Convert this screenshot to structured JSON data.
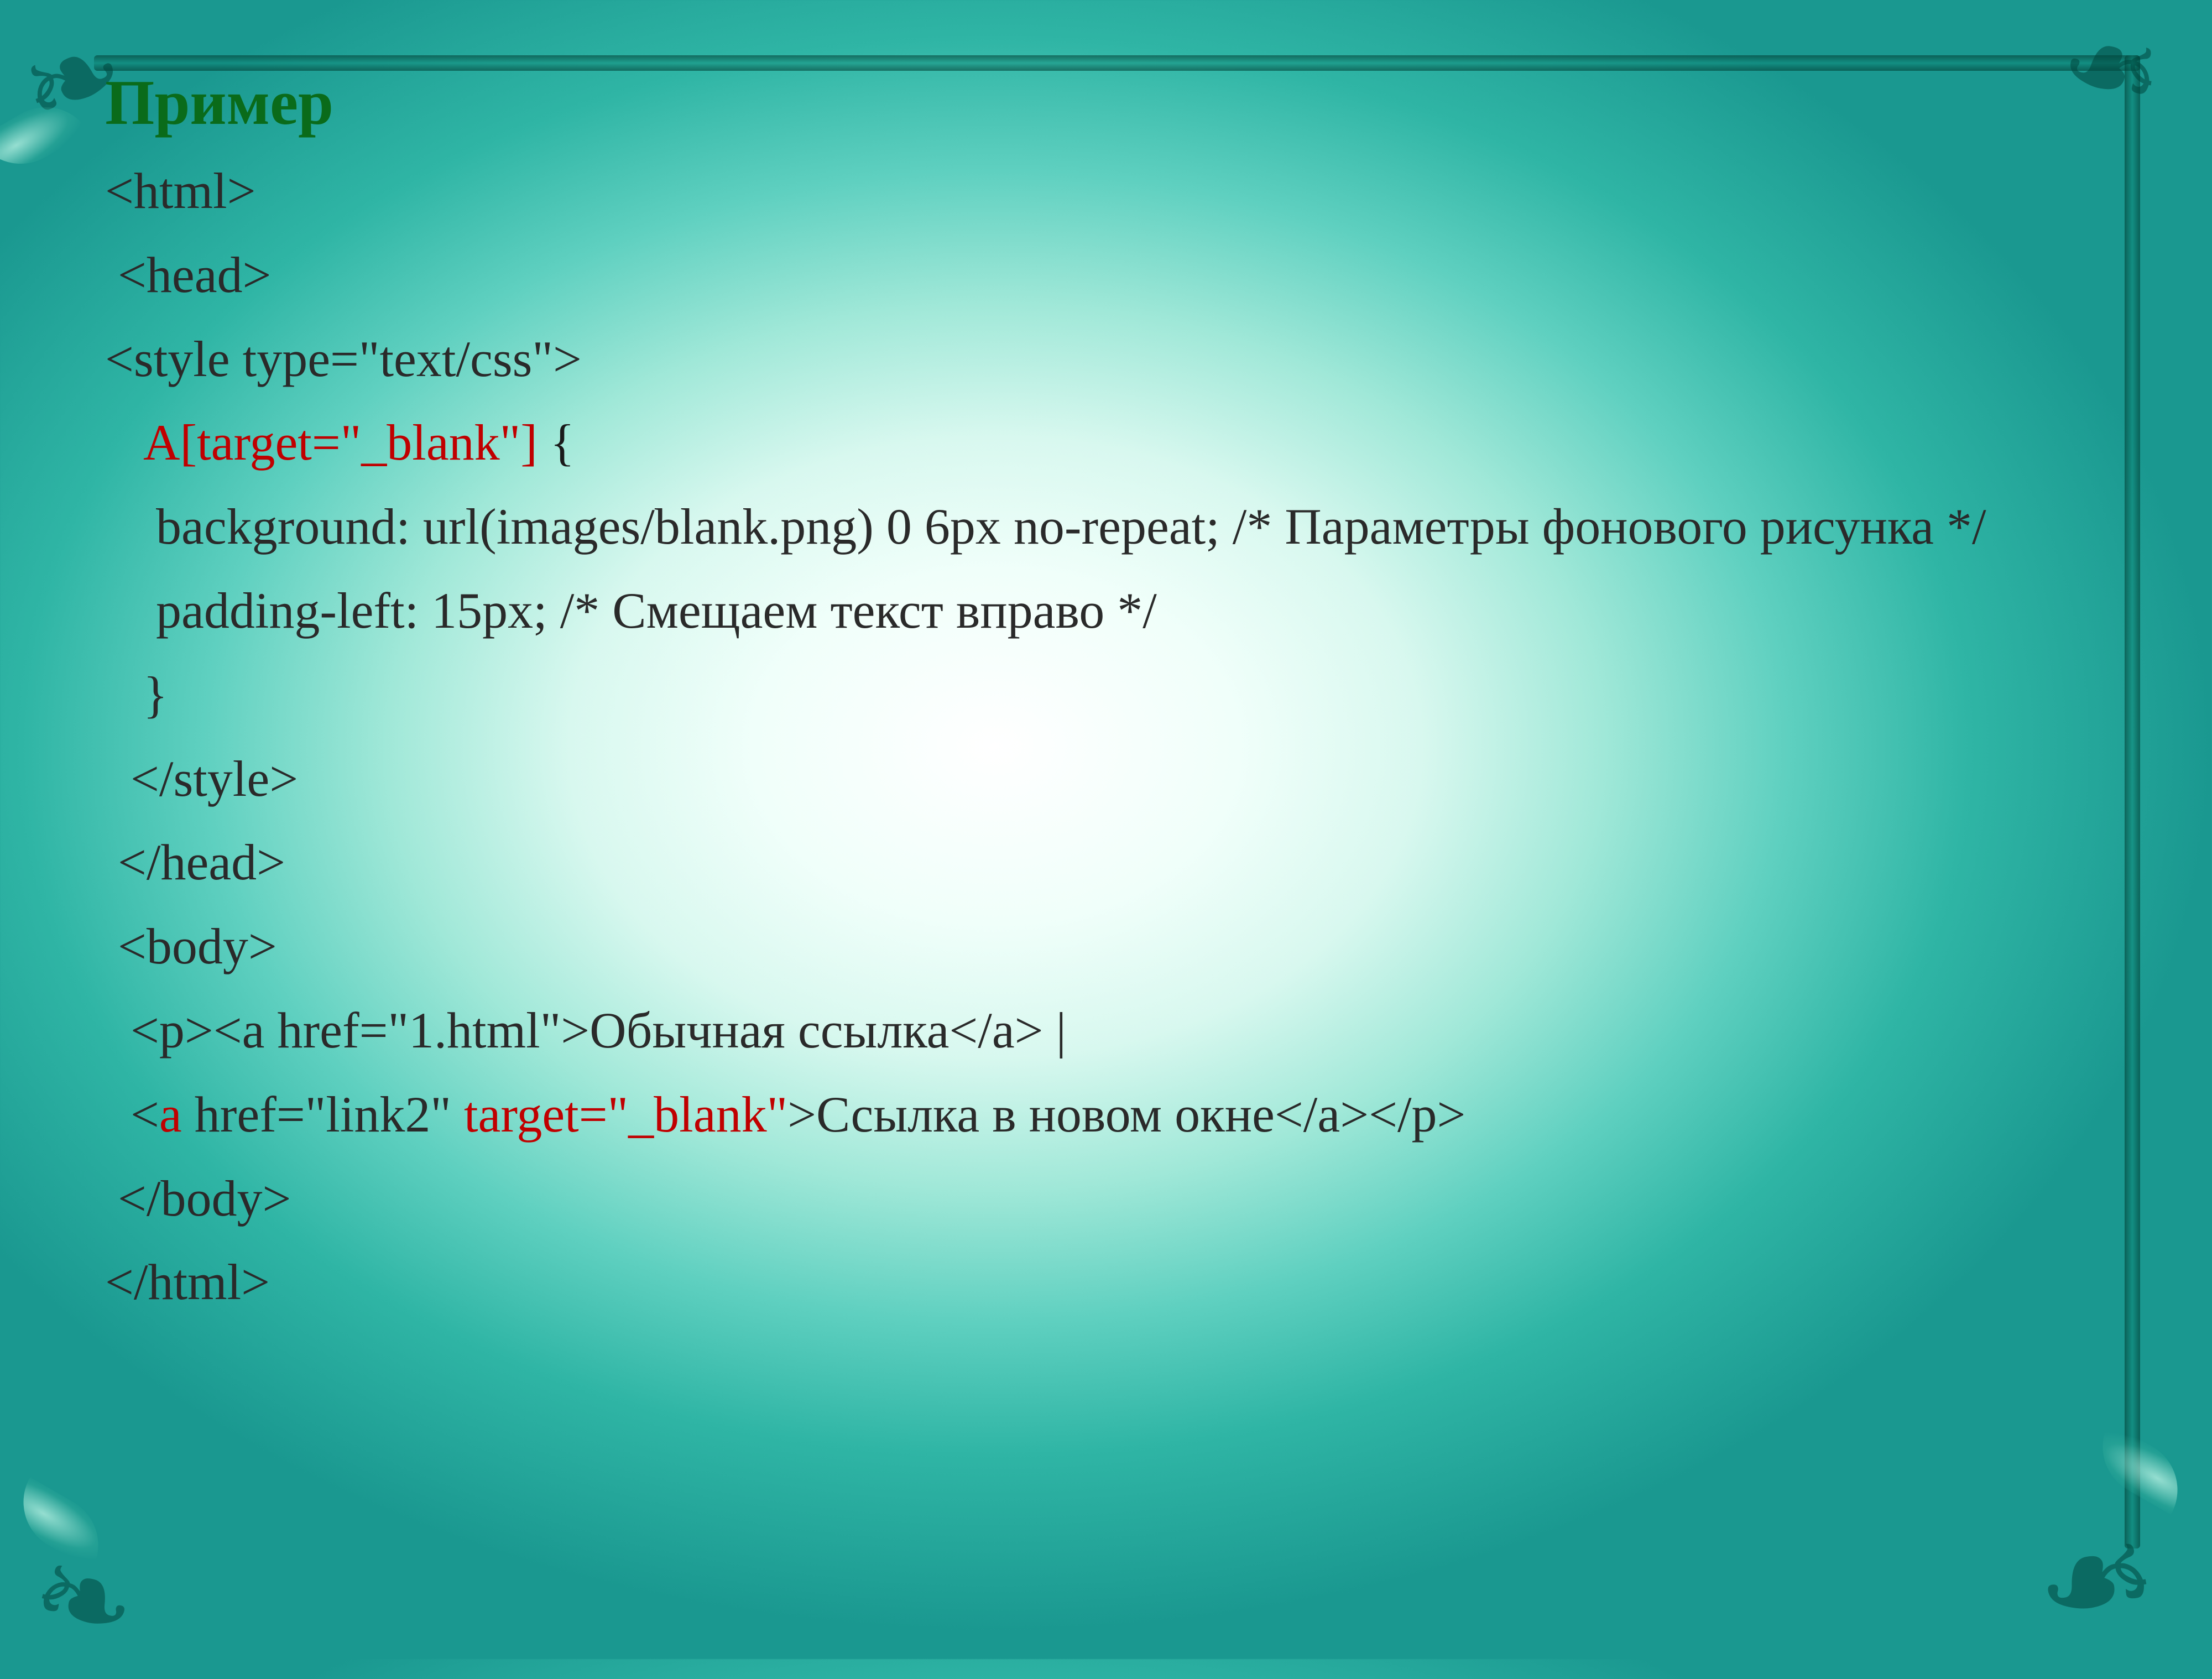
{
  "title": "Пример",
  "code": {
    "l01": "<html>",
    "l02": " <head>",
    "l03": "<style type=\"text/css\">",
    "l04_red": "   A[target=\"_blank\"] ",
    "l04_rest": "{",
    "l05": "    background: url(images/blank.png) 0 6px no-repeat; /* Параметры фонового рисунка */",
    "l06": "    padding-left: 15px; /* Смещаем текст вправо */",
    "l07": "   }",
    "l08": "  </style>",
    "l09": " </head>",
    "l10": " <body>",
    "l11": "  <p><a href=\"1.html\">Обычная ссылка</a> |",
    "l12a": "  <",
    "l12b_red": "a ",
    "l12c": "href=\"link2\" ",
    "l12d_red": "target=\"_blank\"",
    "l12e": ">Ссылка в новом окне</a></p>",
    "l13": " </body>",
    "l14": "</html>"
  }
}
